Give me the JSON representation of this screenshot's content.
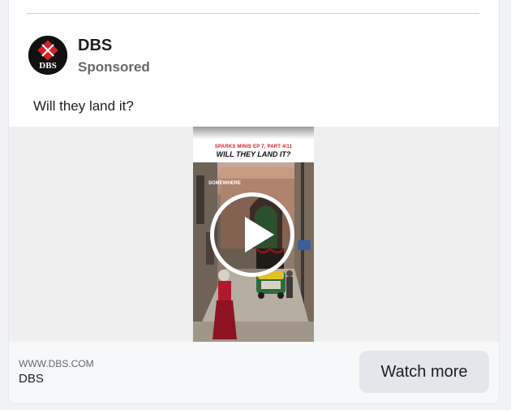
{
  "post": {
    "advertiser": "DBS",
    "sponsored_label": "Sponsored",
    "text": "Will they land it?",
    "logo_text": "DBS"
  },
  "video": {
    "series_label": "SPARKS MINIS EP 7, PART 4/11",
    "headline": "WILL THEY LAND IT?",
    "location_label": "SOMEWHERE"
  },
  "link": {
    "domain": "WWW.DBS.COM",
    "title": "DBS",
    "cta_label": "Watch more"
  },
  "colors": {
    "brand_red": "#d31f26",
    "cta_background": "#e4e6eb"
  },
  "icons": {
    "play": "play-icon",
    "logo": "dbs-logo"
  }
}
